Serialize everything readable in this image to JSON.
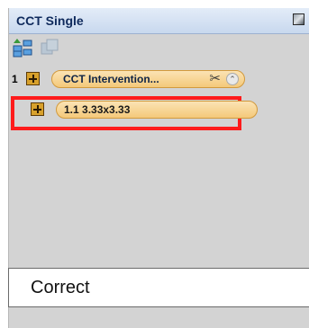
{
  "window": {
    "title": "CCT Single"
  },
  "toolbar": {
    "add_icon": "add-node-icon",
    "copy_icon": "copy-node-icon"
  },
  "tree": {
    "items": [
      {
        "number": "1",
        "label": "CCT Intervention...",
        "expand_icon": "plus-box-icon",
        "cut_icon": "scissors-icon",
        "collapse_icon": "chevron-up-icon"
      },
      {
        "label": "1.1  3.33x3.33",
        "expand_icon": "plus-box-icon",
        "highlighted": true
      }
    ]
  },
  "footer": {
    "text": "Correct"
  },
  "colors": {
    "highlight": "#ff1b1b",
    "pill_fill": "#f4c97a",
    "panel_bg": "#d3d3d3"
  }
}
